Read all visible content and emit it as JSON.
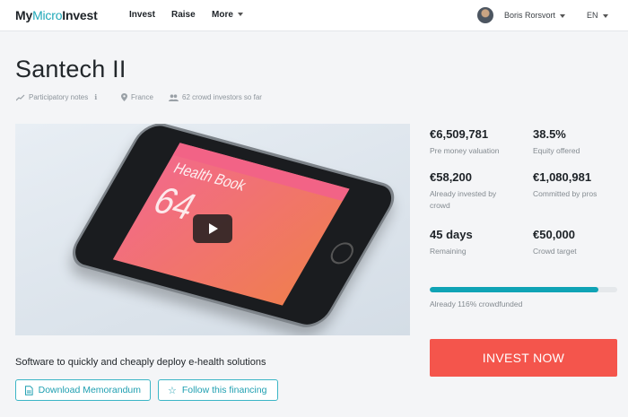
{
  "nav": {
    "logo_prefix": "My",
    "logo_mid": "Micro",
    "logo_suffix": "Invest",
    "links": [
      "Invest",
      "Raise",
      "More"
    ],
    "user_name": "Boris Rorsvort",
    "language": "EN"
  },
  "project": {
    "title": "Santech II",
    "type": "Participatory notes",
    "country": "France",
    "investors": "62 crowd investors so far",
    "tagline": "Software to quickly and cheaply deploy e-health solutions",
    "video_screen_title": "Health Book",
    "video_screen_value": "64"
  },
  "buttons": {
    "download": "Download Memorandum",
    "follow": "Follow this financing",
    "invest": "INVEST NOW"
  },
  "stats": [
    {
      "value": "€6,509,781",
      "label": "Pre money valuation"
    },
    {
      "value": "38.5%",
      "label": "Equity offered"
    },
    {
      "value": "€58,200",
      "label": "Already invested by crowd"
    },
    {
      "value": "€1,080,981",
      "label": "Committed by pros"
    },
    {
      "value": "45 days",
      "label": "Remaining"
    },
    {
      "value": "€50,000",
      "label": "Crowd target"
    }
  ],
  "progress": {
    "label": "Already 116% crowdfunded",
    "fill_fraction": 0.9,
    "color": "#0fa3b5"
  },
  "colors": {
    "accent": "#1fa8b8",
    "invest_button": "#f4554c"
  }
}
